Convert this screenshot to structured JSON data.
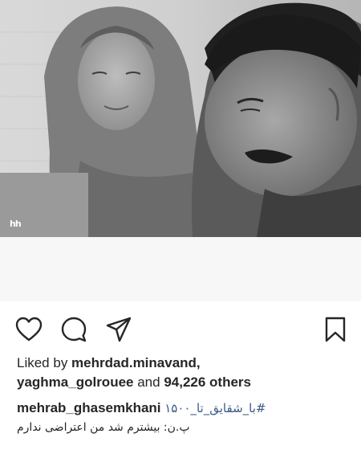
{
  "post": {
    "image": {
      "description_icon": "photo-image",
      "watermark": "hh"
    },
    "actions": {
      "like_icon": "heart-icon",
      "comment_icon": "comment-icon",
      "share_icon": "share-icon",
      "save_icon": "bookmark-icon"
    },
    "likes": {
      "prefix": "Liked by ",
      "user1": "mehrdad.minavand",
      "separator": ",",
      "user2": "yaghma_golrouee",
      "middle": " and ",
      "count": "94,226 others"
    },
    "caption": {
      "author": "mehrab_ghasemkhani",
      "hashtag": "#با_شقایق_تا_۱۵۰۰",
      "line2": "پ.ن: بیشترم شد من اعتراضی ندارم"
    }
  },
  "colors": {
    "text": "#262626",
    "hashtag": "#3b5a85",
    "background": "#ffffff",
    "blank_area": "#f7f7f7"
  }
}
